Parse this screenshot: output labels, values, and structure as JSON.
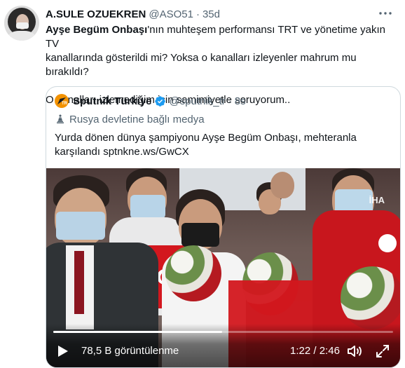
{
  "tweet": {
    "author_name": "A.SULE OZUEKREN",
    "author_handle": "@ASO51",
    "separator": "·",
    "time_ago": "35d",
    "more_icon": "more-horizontal-icon",
    "text_bold": "Ayşe Begüm Onbaşı",
    "text_line1_rest": "'nın muhteşem performansı TRT ve yönetime yakın TV",
    "text_line2": "kanallarında gösterildi mi? Yoksa o kanalları izleyenler mahrum mu bırakıldı?",
    "text_line3": "O kanalları  izlemediğim için samimiyetle soruyorum.."
  },
  "quote": {
    "author_name": "Sputnik Türkiye",
    "author_handle": "@sputnik_tr",
    "separator": "·",
    "time_ago": "8s",
    "logo_text": "TR",
    "label": "Rusya devletine bağlı medya",
    "label_icon": "state-media-icon",
    "verified_icon": "verified-badge-icon",
    "text_line1": "Yurda dönen dünya şampiyonu Ayşe Begüm Onbaşı, mehteranla",
    "text_line2": "karşılandı sptnkne.ws/GwCX"
  },
  "video": {
    "watermark": "İHA",
    "views": "78,5 B görüntülenme",
    "time_current": "1:22",
    "time_separator": "/",
    "time_total": "2:46",
    "progress_fraction": 0.497,
    "play_icon": "play-icon",
    "volume_icon": "volume-icon",
    "fullscreen_icon": "fullscreen-icon"
  },
  "colors": {
    "accent": "#1d9bf0",
    "secondary_text": "#536471",
    "primary_text": "#0f1419",
    "border": "#cfd9de",
    "logo_orange": "#f39200"
  }
}
